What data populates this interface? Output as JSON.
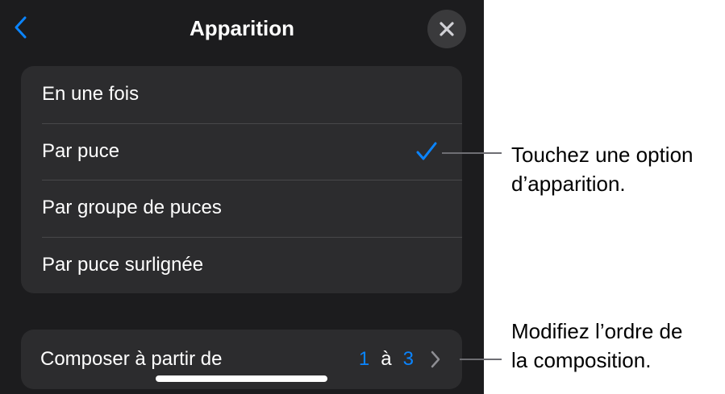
{
  "header": {
    "title": "Apparition",
    "back_icon": "chevron-left-icon",
    "close_icon": "close-icon"
  },
  "options": [
    {
      "label": "En une fois",
      "selected": false
    },
    {
      "label": "Par puce",
      "selected": true
    },
    {
      "label": "Par groupe de puces",
      "selected": false
    },
    {
      "label": "Par puce surlignée",
      "selected": false
    }
  ],
  "compose": {
    "label": "Composer à partir de",
    "from": "1",
    "separator": "à",
    "to": "3",
    "chevron_icon": "chevron-right-icon"
  },
  "callouts": {
    "option": {
      "line1": "Touchez une option",
      "line2": "d’apparition."
    },
    "order": {
      "line1": "Modifiez l’ordre de",
      "line2": "la composition."
    }
  },
  "colors": {
    "accent": "#0a84ff",
    "panel_background": "#1c1c1e",
    "group_background": "#2c2c2e"
  }
}
